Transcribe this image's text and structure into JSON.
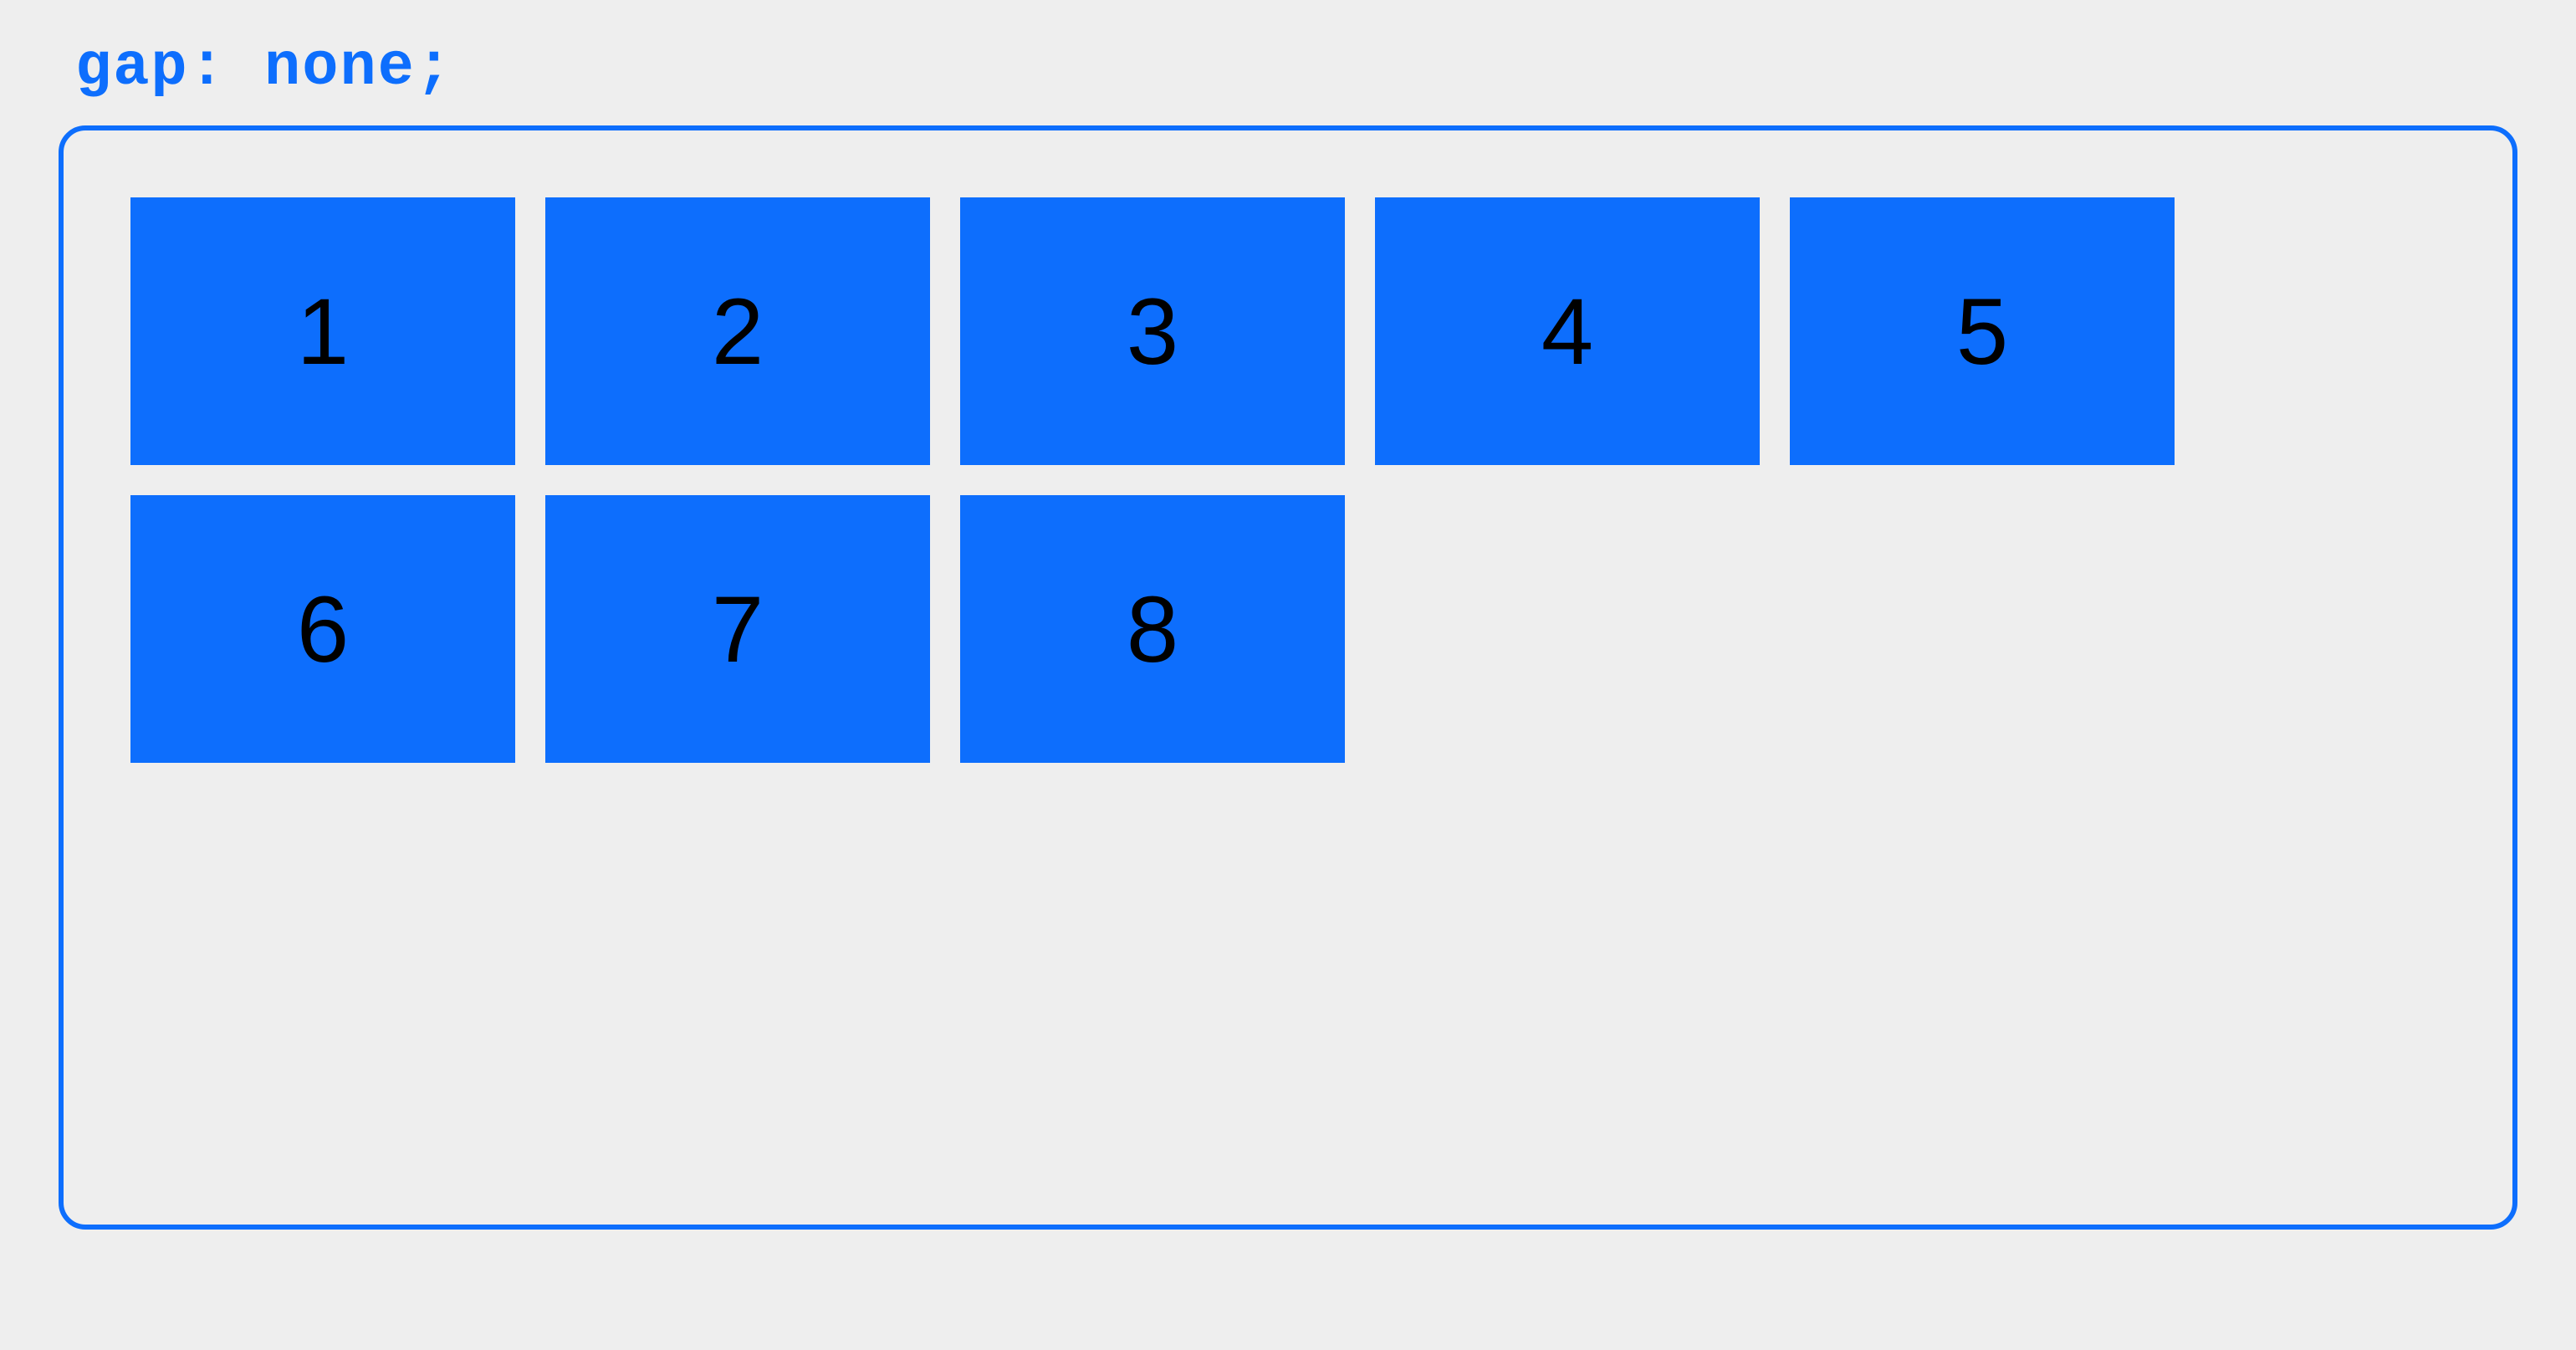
{
  "code_label": "gap: none;",
  "boxes": {
    "items": [
      "1",
      "2",
      "3",
      "4",
      "5",
      "6",
      "7",
      "8"
    ]
  },
  "colors": {
    "accent": "#0d6efd",
    "background": "#eeeeee",
    "box_text": "#000000"
  }
}
